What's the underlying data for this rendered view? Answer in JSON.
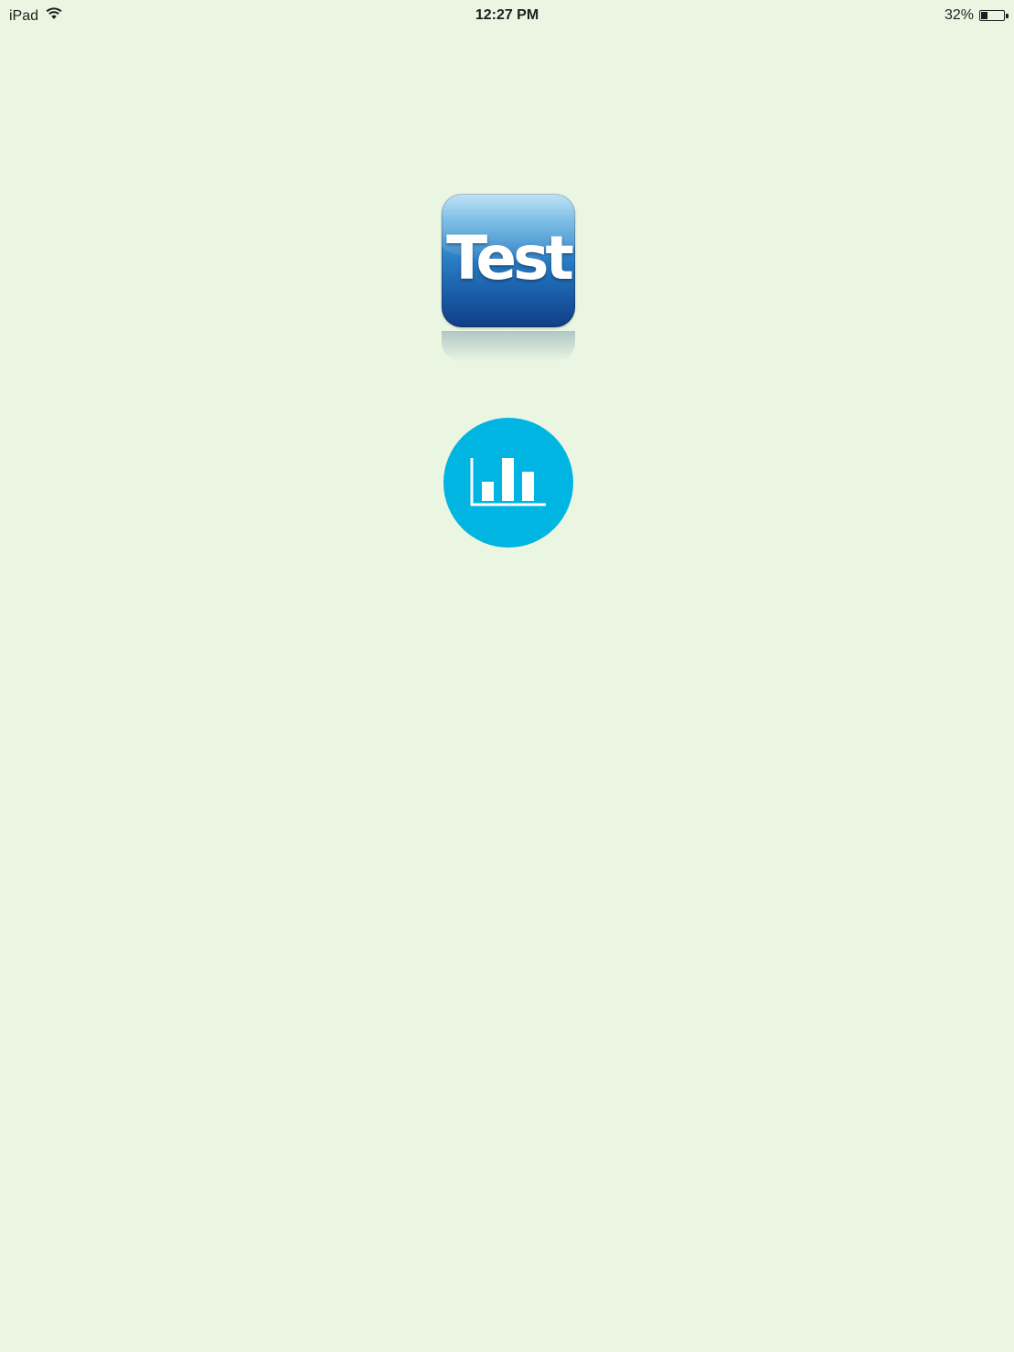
{
  "status_bar": {
    "device": "iPad",
    "time": "12:27 PM",
    "battery_percent": "32%",
    "battery_level": 0.32
  },
  "app_icon": {
    "label": "Test",
    "colors": {
      "top": "#9fd3ef",
      "bottom": "#103f86"
    }
  },
  "chart_button": {
    "icon": "bar-chart-icon",
    "color": "#00b5e2"
  },
  "colors": {
    "background": "#eaf6e2"
  }
}
